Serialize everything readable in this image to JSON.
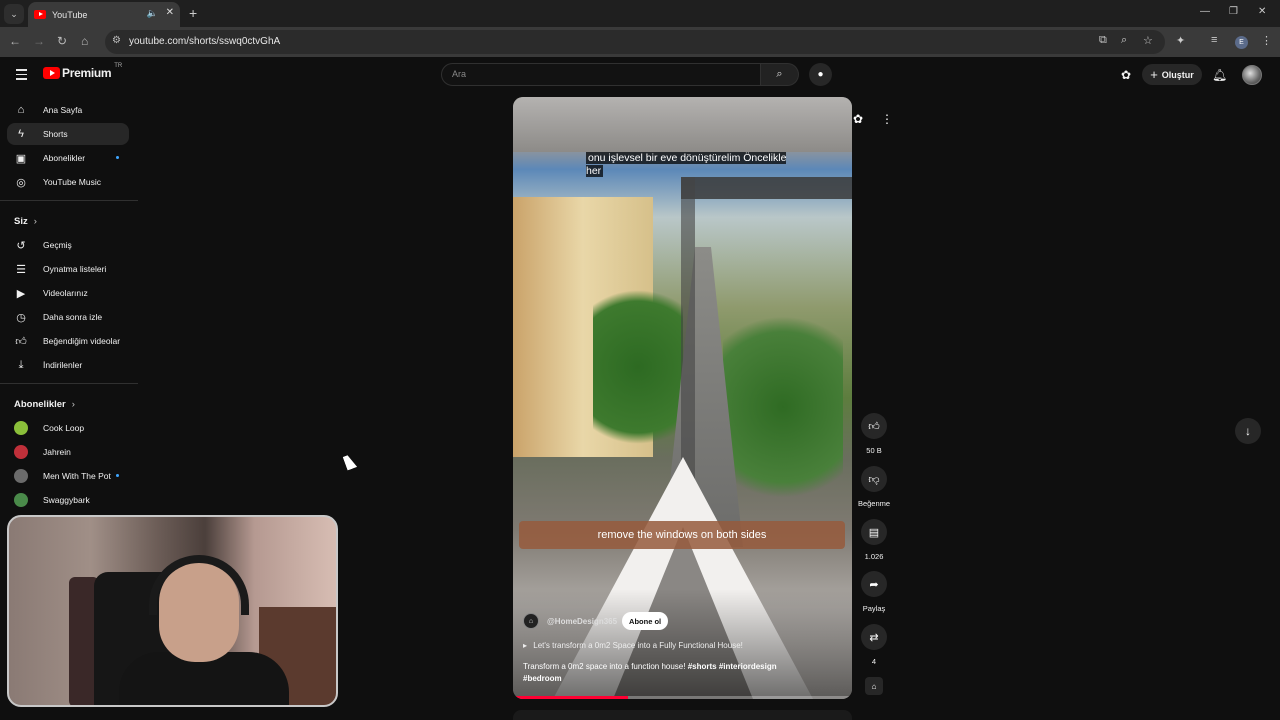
{
  "browser": {
    "tab_title": "YouTube",
    "url": "youtube.com/shorts/sswq0ctvGhA",
    "profile_initial": "E"
  },
  "header": {
    "logo_text": "Premium",
    "country_code": "TR",
    "search_placeholder": "Ara",
    "create_label": "Oluştur"
  },
  "sidebar": {
    "main": [
      {
        "label": "Ana Sayfa",
        "icon": "home-icon"
      },
      {
        "label": "Shorts",
        "icon": "shorts-icon"
      },
      {
        "label": "Abonelikler",
        "icon": "subscriptions-icon"
      },
      {
        "label": "YouTube Music",
        "icon": "music-icon"
      }
    ],
    "you_heading": "Siz",
    "you_items": [
      {
        "label": "Geçmiş",
        "icon": "history-icon"
      },
      {
        "label": "Oynatma listeleri",
        "icon": "playlists-icon"
      },
      {
        "label": "Videolarınız",
        "icon": "your-videos-icon"
      },
      {
        "label": "Daha sonra izle",
        "icon": "watch-later-icon"
      },
      {
        "label": "Beğendiğim videolar",
        "icon": "liked-icon"
      },
      {
        "label": "İndirilenler",
        "icon": "download-icon"
      }
    ],
    "subs_heading": "Abonelikler",
    "subscriptions": [
      {
        "label": "Cook Loop",
        "color": "#8bbf3a"
      },
      {
        "label": "Jahrein",
        "color": "#c0303a"
      },
      {
        "label": "Men With The Pot",
        "color": "#6b6b6b"
      },
      {
        "label": "Swaggybark",
        "color": "#4a8a4a"
      }
    ]
  },
  "short": {
    "caption_top": "onu işlevsel bir eve dönüştürelim Öncelikle her",
    "caption_bottom": "remove the windows on both sides",
    "channel": "@HomeDesign365",
    "subscribe_label": "Abone ol",
    "song": "Let's transform a 0m2 Space into a Fully Functional House!",
    "description": "Transform a 0m2 space into a function house!",
    "hashtags": "#shorts #interiordesign #bedroom",
    "progress": 0.34
  },
  "actions": {
    "likes": "50 B",
    "dislike_label": "Beğenme",
    "comments": "1.026",
    "share_label": "Paylaş",
    "remix_count": "4"
  },
  "colors": {
    "accent": "#ff0000",
    "background": "#0f0f0f"
  }
}
